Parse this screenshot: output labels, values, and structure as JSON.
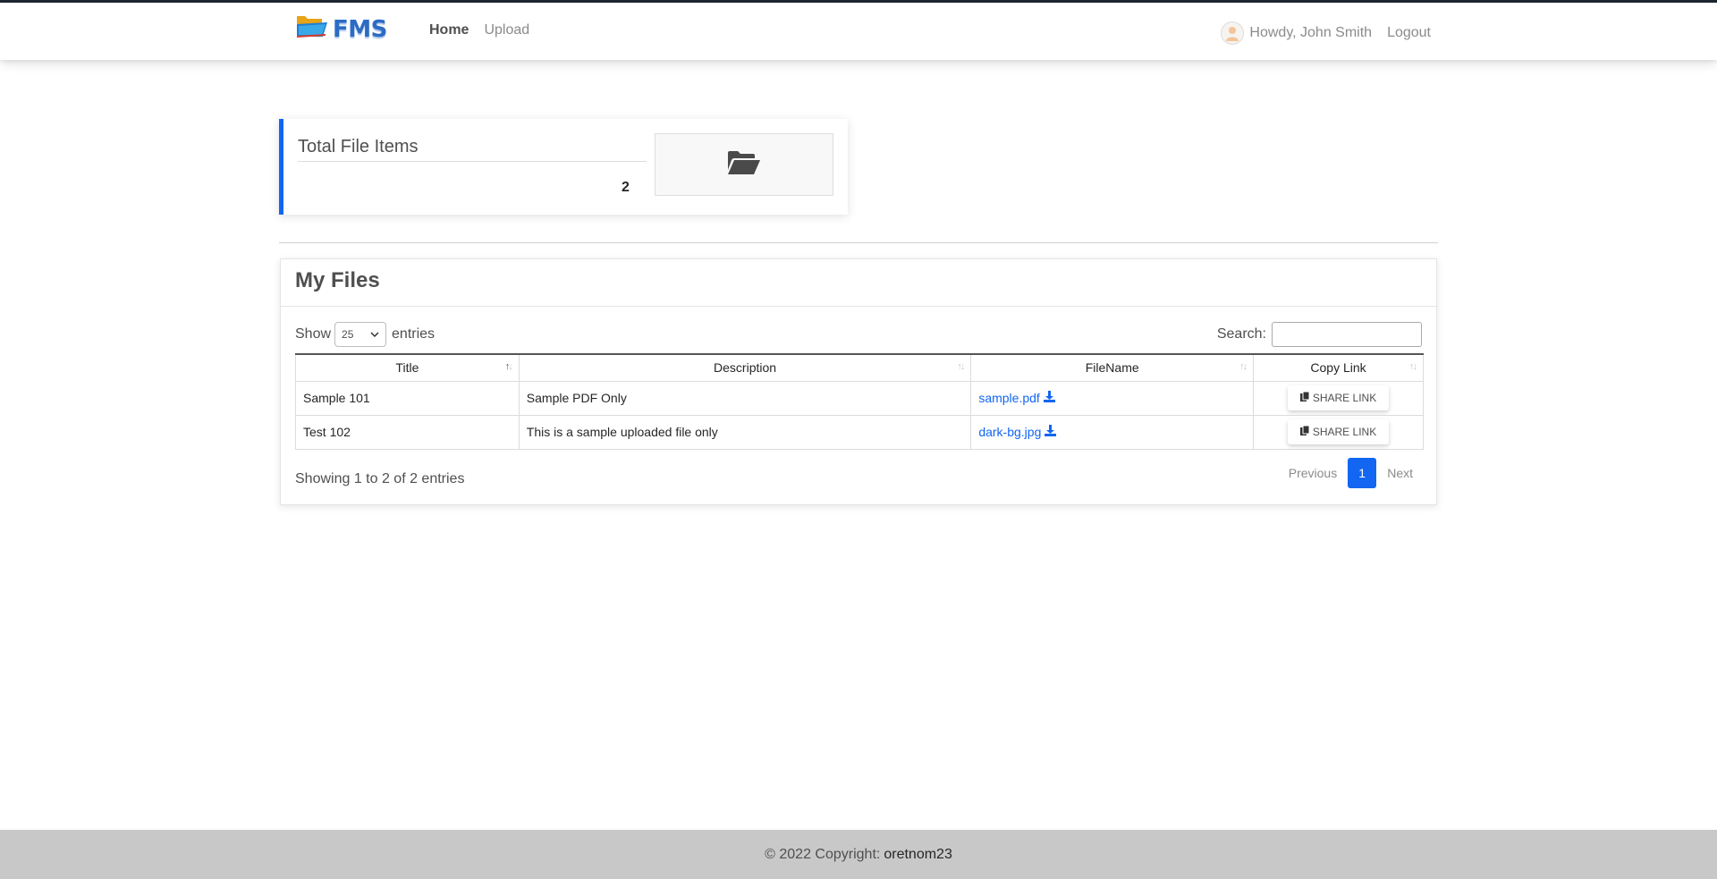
{
  "nav": {
    "brand": "FMS",
    "links": [
      {
        "label": "Home",
        "active": true
      },
      {
        "label": "Upload",
        "active": false
      }
    ],
    "greeting": "Howdy, John Smith",
    "logout": "Logout"
  },
  "stats": {
    "title": "Total File Items",
    "value": "2",
    "icon": "folder-open-icon"
  },
  "files": {
    "title": "My Files",
    "show_label": "Show",
    "entries_label": "entries",
    "page_size": "25",
    "search_label": "Search:",
    "search_value": "",
    "columns": [
      "Title",
      "Description",
      "FileName",
      "Copy Link"
    ],
    "rows": [
      {
        "title": "Sample 101",
        "description": "Sample PDF Only",
        "filename": "sample.pdf",
        "action": "SHARE LINK"
      },
      {
        "title": "Test 102",
        "description": "This is a sample uploaded file only",
        "filename": "dark-bg.jpg",
        "action": "SHARE LINK"
      }
    ],
    "info": "Showing 1 to 2 of 2 entries",
    "pagination": {
      "previous": "Previous",
      "current": "1",
      "next": "Next"
    }
  },
  "footer": {
    "copyright": "© 2022 Copyright:",
    "brand": "oretnom23"
  },
  "colors": {
    "accent": "#1266f1",
    "nav_border": "#1e2331",
    "footer_bg": "#c8c8c8"
  }
}
